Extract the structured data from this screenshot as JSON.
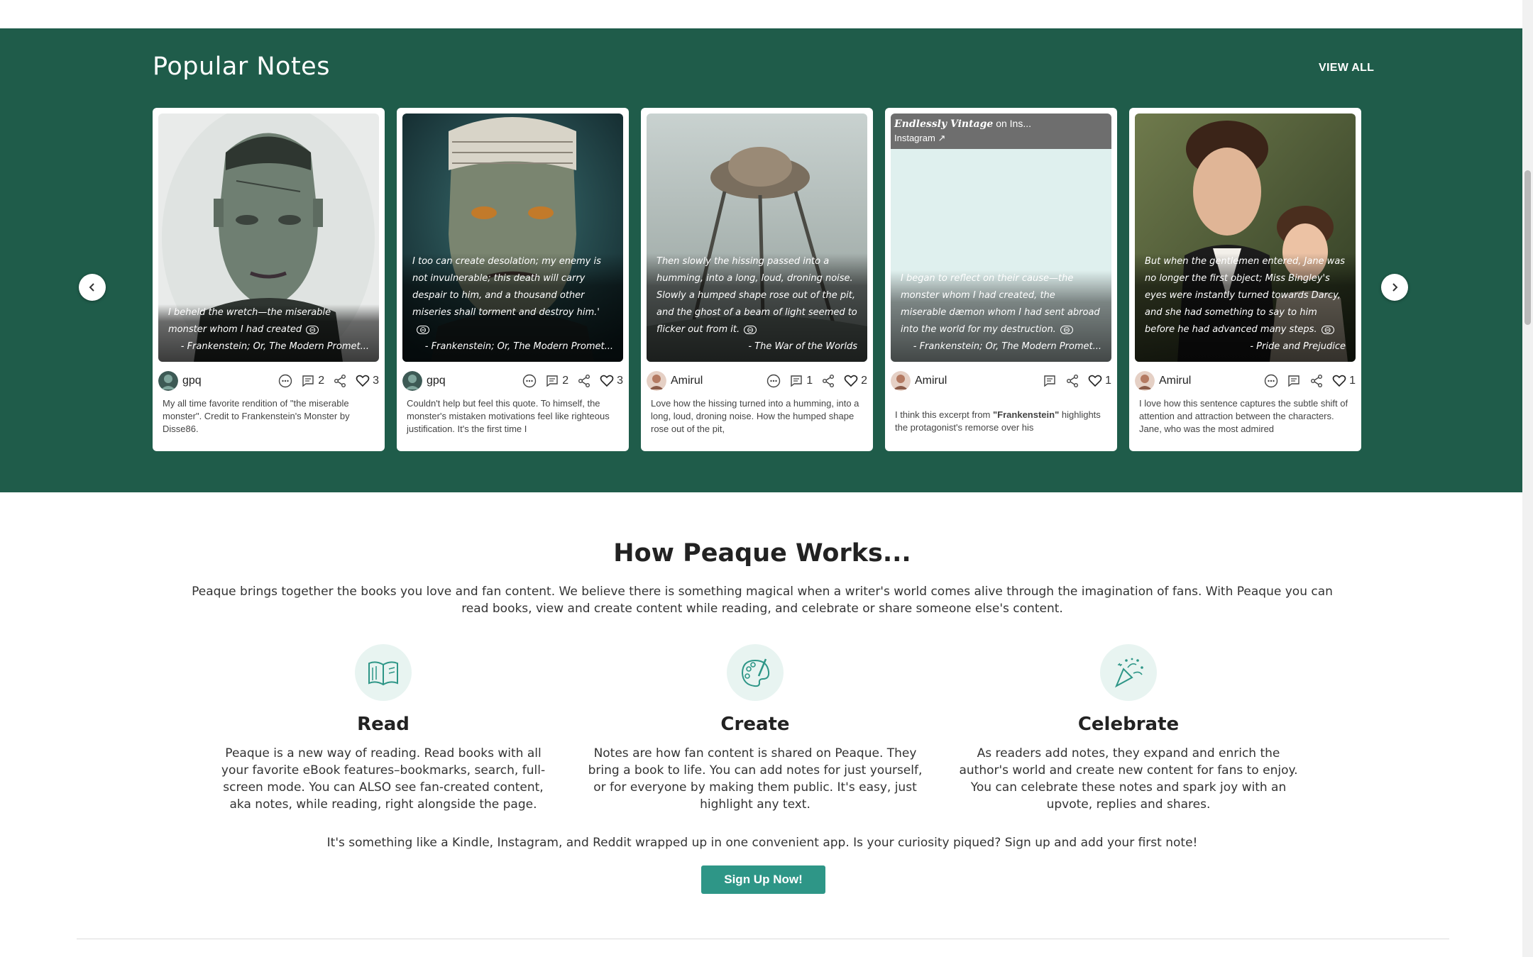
{
  "popular": {
    "title": "Popular Notes",
    "view_all": "VIEW ALL",
    "cards": [
      {
        "quote": "I beheld the wretch—the miserable monster whom I had created",
        "source": "- Frankenstein; Or, The Modern Promet...",
        "user": "gpq",
        "comments": "2",
        "likes": "3",
        "desc": "My all time favorite rendition of \"the miserable monster\". Credit to Frankenstein's Monster by Disse86."
      },
      {
        "quote": "I too can create desolation; my enemy is not invulnerable; this death will carry despair to him, and a thousand other miseries shall torment and destroy him.'",
        "source": "- Frankenstein; Or, The Modern Promet...",
        "user": "gpq",
        "comments": "2",
        "likes": "3",
        "desc": "Couldn't help but feel this quote. To himself, the monster's mistaken motivations feel like righteous justification. It's the first time I"
      },
      {
        "quote": "Then slowly the hissing passed into a humming, into a long, loud, droning noise. Slowly a humped shape rose out of the pit, and the ghost of a beam of light seemed to flicker out from it.",
        "source": "- The War of the Worlds",
        "user": "Amirul",
        "comments": "1",
        "likes": "2",
        "desc": "Love how the hissing turned into a humming, into a long, loud, droning noise. How the humped shape rose out of the pit,"
      },
      {
        "ig_name": "Endlessly Vintage",
        "ig_name_suffix": "on Ins...",
        "ig_sub": "Instagram",
        "quote": "I began to reflect on their cause—the monster whom I had created, the miserable dæmon whom I had sent abroad into the world for my destruction.",
        "source": "- Frankenstein; Or, The Modern Promet...",
        "user": "Amirul",
        "likes": "1",
        "desc_pre": "I think this excerpt from ",
        "desc_bold": "\"Frankenstein\"",
        "desc_post": " highlights the protagonist's remorse over his"
      },
      {
        "quote": "But when the gentlemen entered, Jane was no longer the first object; Miss Bingley's eyes were instantly turned towards Darcy, and she had something to say to him before he had advanced many steps.",
        "source": "- Pride and Prejudice",
        "user": "Amirul",
        "likes": "1",
        "desc": "I love how this sentence captures the subtle shift of attention and attraction between the characters. Jane, who was the most admired"
      }
    ]
  },
  "how": {
    "title": "How Peaque Works...",
    "intro": "Peaque brings together the books you love and fan content. We believe there is something magical when a writer's world comes alive through the imagination of fans. With Peaque you can read books, view and create content while reading, and celebrate or share someone else's content.",
    "features": [
      {
        "title": "Read",
        "icon": "open-book-icon",
        "text": "Peaque is a new way of reading. Read books with all your favorite eBook features–bookmarks, search, full-screen mode. You can ALSO see fan-created content, aka notes, while reading, right alongside the page."
      },
      {
        "title": "Create",
        "icon": "palette-brush-icon",
        "text": "Notes are how fan content is shared on Peaque. They bring a book to life. You can add notes for just yourself, or for everyone by making them public. It's easy, just highlight any text."
      },
      {
        "title": "Celebrate",
        "icon": "party-popper-icon",
        "text": "As readers add notes, they expand and enrich the author's world and create new content for fans to enjoy. You can celebrate these notes and spark joy with an upvote, replies and shares."
      }
    ],
    "closing": "It's something like a Kindle, Instagram, and Reddit wrapped up in one convenient app. Is your curiosity piqued? Sign up and add your first note!",
    "signup": "Sign Up Now!"
  },
  "colors": {
    "band": "#1f5c4a",
    "accent": "#2e9687",
    "icon_bg": "#e8f4f1"
  }
}
